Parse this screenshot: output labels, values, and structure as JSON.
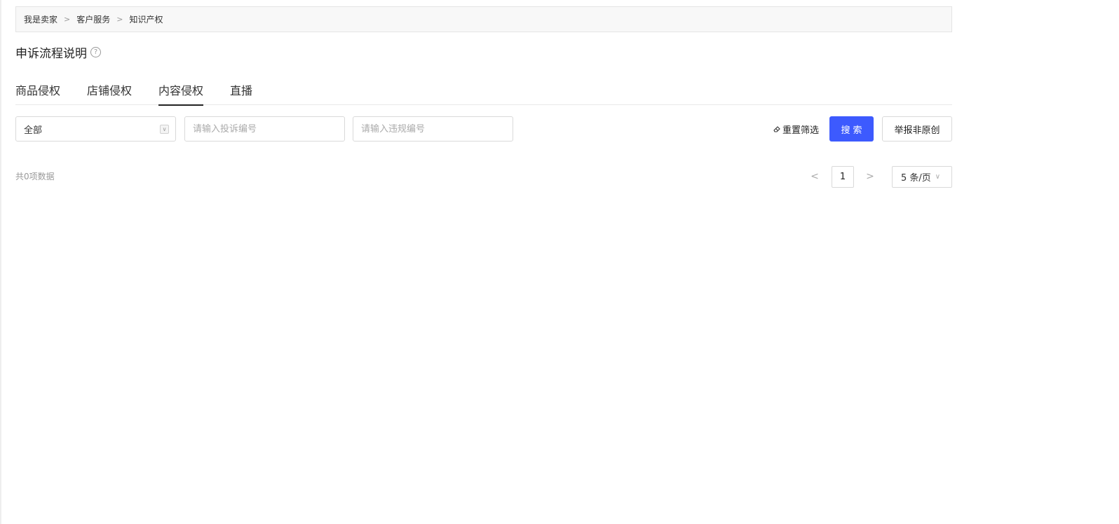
{
  "breadcrumb": {
    "items": [
      "我是卖家",
      "客户服务",
      "知识产权"
    ],
    "separator": ">"
  },
  "page": {
    "title": "申诉流程说明",
    "help_icon": "help-circle-icon"
  },
  "tabs": [
    {
      "label": "商品侵权",
      "active": false
    },
    {
      "label": "店铺侵权",
      "active": false
    },
    {
      "label": "内容侵权",
      "active": true
    },
    {
      "label": "直播",
      "active": false
    }
  ],
  "filters": {
    "type_select": {
      "value": "全部",
      "icon": "chevron-down-icon"
    },
    "complaint_no": {
      "value": "",
      "placeholder": "请输入投诉编号"
    },
    "violation_no": {
      "value": "",
      "placeholder": "请输入违规编号"
    }
  },
  "actions": {
    "reset_label": "重置筛选",
    "reset_icon": "eraser-icon",
    "search_label": "搜索",
    "report_label": "举报非原创",
    "primary_color": "#3d5afe"
  },
  "pagination": {
    "total_text": "共0项数据",
    "prev_icon": "chevron-left-icon",
    "next_icon": "chevron-right-icon",
    "current_page": "1",
    "page_size_label": "5 条/页",
    "page_size_icon": "chevron-down-icon"
  }
}
